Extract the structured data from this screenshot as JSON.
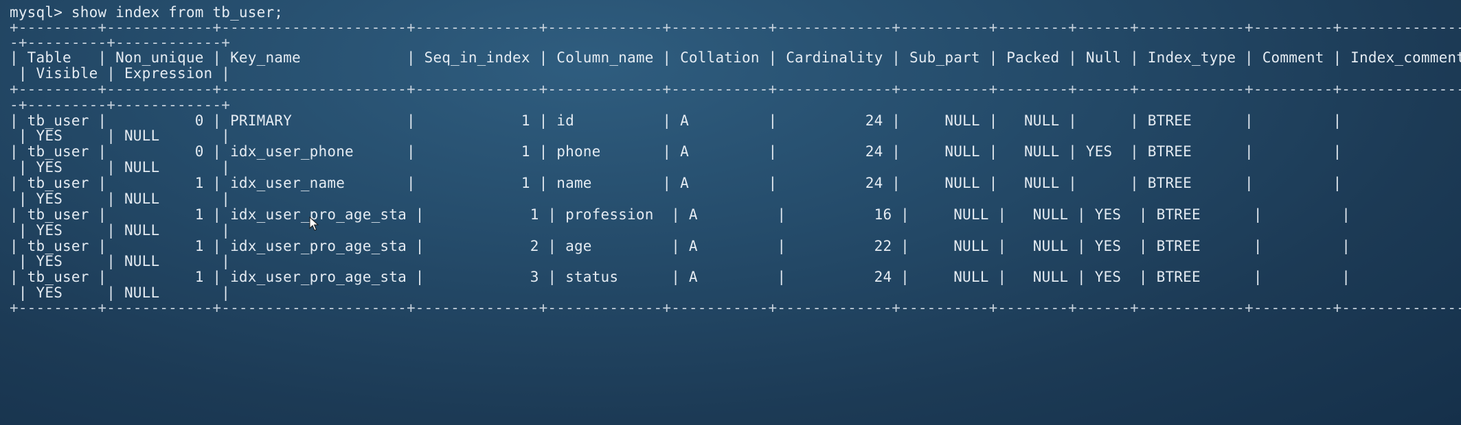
{
  "terminal": {
    "prompt": "mysql> show index from tb_user;",
    "border_line": "+---------+------------+---------------------+--------------+-------------+-----------+-------------+----------+--------+------+------------+---------+---------------",
    "border_wrap": "-+---------+------------+",
    "header_line": "| Table   | Non_unique | Key_name            | Seq_in_index | Column_name | Collation | Cardinality | Sub_part | Packed | Null | Index_type | Comment | Index_comment",
    "header_wrap": " | Visible | Expression |",
    "rows": [
      {
        "line": "| tb_user |          0 | PRIMARY             |            1 | id          | A         |          24 |     NULL |   NULL |      | BTREE      |         |",
        "wrap": " | YES     | NULL       |"
      },
      {
        "line": "| tb_user |          0 | idx_user_phone      |            1 | phone       | A         |          24 |     NULL |   NULL | YES  | BTREE      |         |",
        "wrap": " | YES     | NULL       |"
      },
      {
        "line": "| tb_user |          1 | idx_user_name       |            1 | name        | A         |          24 |     NULL |   NULL |      | BTREE      |         |",
        "wrap": " | YES     | NULL       |"
      },
      {
        "line": "| tb_user |          1 | idx_user_pro_age_sta |            1 | profession  | A         |          16 |     NULL |   NULL | YES  | BTREE      |         |",
        "wrap": " | YES     | NULL       |"
      },
      {
        "line": "| tb_user |          1 | idx_user_pro_age_sta |            2 | age         | A         |          22 |     NULL |   NULL | YES  | BTREE      |         |",
        "wrap": " | YES     | NULL       |"
      },
      {
        "line": "| tb_user |          1 | idx_user_pro_age_sta |            3 | status      | A         |          24 |     NULL |   NULL | YES  | BTREE      |         |",
        "wrap": " | YES     | NULL       |"
      }
    ],
    "colors": {
      "background": "#254c6b",
      "text": "#e4ebf2"
    }
  }
}
